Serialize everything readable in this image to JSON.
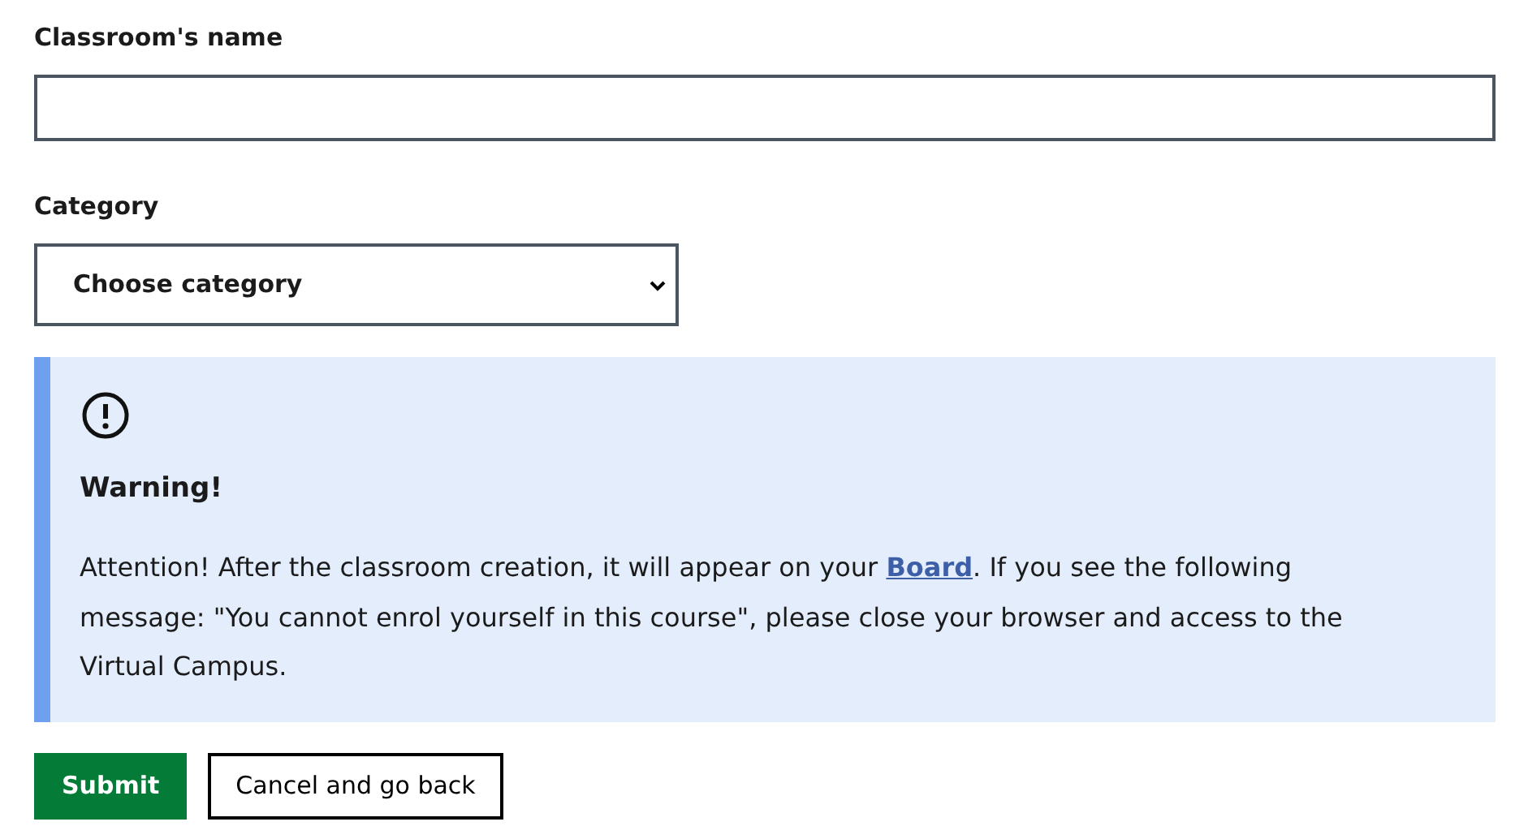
{
  "name_field": {
    "label": "Classroom's name"
  },
  "category_field": {
    "label": "Category",
    "value": "Choose category"
  },
  "alert": {
    "title": "Warning!",
    "text_before": "Attention! After the classroom creation, it will appear on your ",
    "link": "Board",
    "text_after": ". If you see the following message: \"You cannot enrol yourself in this course\", please close your browser and access to the Virtual Campus."
  },
  "buttons": [
    {
      "label": "Submit",
      "kind": "primary"
    },
    {
      "label": "Cancel and go back",
      "kind": "secondary"
    }
  ]
}
